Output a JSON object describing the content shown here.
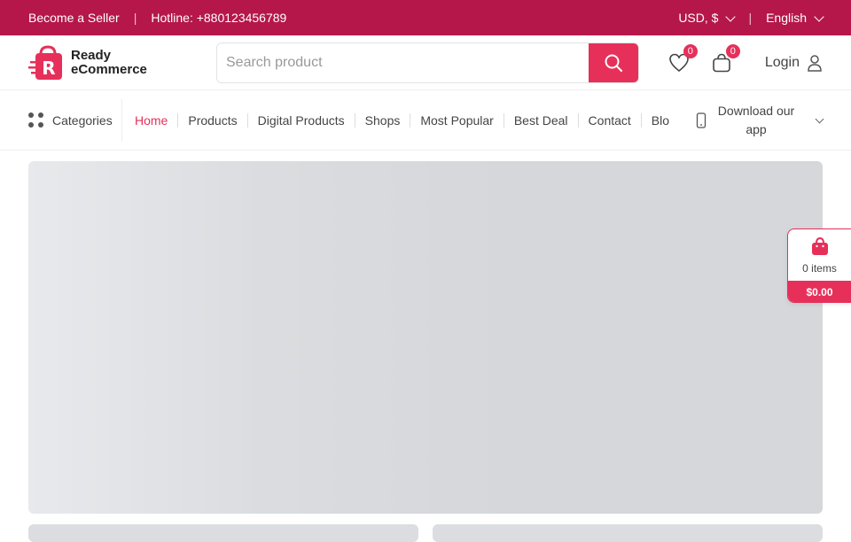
{
  "topbar": {
    "seller_link": "Become a Seller",
    "divider": "|",
    "hotline": "Hotline: +880123456789",
    "currency": "USD, $",
    "language": "English"
  },
  "header": {
    "logo_line1": "Ready",
    "logo_line2": "eCommerce",
    "search_placeholder": "Search product",
    "wishlist_count": "0",
    "cart_count": "0",
    "login_label": "Login"
  },
  "nav": {
    "categories_label": "Categories",
    "items": [
      {
        "label": "Home"
      },
      {
        "label": "Products"
      },
      {
        "label": "Digital Products"
      },
      {
        "label": "Shops"
      },
      {
        "label": "Most Popular"
      },
      {
        "label": "Best Deal"
      },
      {
        "label": "Contact"
      },
      {
        "label": "Blo"
      }
    ],
    "download_label": "Download our app"
  },
  "float_cart": {
    "items_label": "0 items",
    "total": "$0.00"
  },
  "colors": {
    "topbar": "#b5174b",
    "accent": "#e6305a"
  }
}
